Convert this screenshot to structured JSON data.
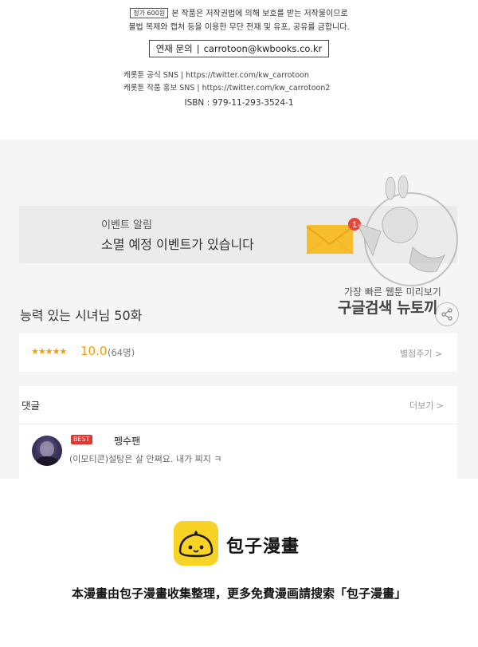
{
  "credits": {
    "price_tag": "정가 600원",
    "notice_line1": "본 작품은 저작권법에 의해 보호를 받는 저작물이므로",
    "notice_line2": "불법 복제와 캡처 등을 이용한 무단 전재 및 유포, 공유를 금합니다.",
    "contact_label": "연재 문의",
    "contact_email": "carrotoon@kwbooks.co.kr",
    "sns_official": "캐롯툰 공식 SNS | https://twitter.com/kw_carrotoon",
    "sns_promo": "캐롯툰 작품 홍보 SNS | https://twitter.com/kw_carrotoon2",
    "isbn": "ISBN : 979-11-293-3524-1"
  },
  "event": {
    "label": "이벤트 알림",
    "title": "소멸 예정 이벤트가 있습니다",
    "badge_count": "1",
    "icon": "envelope-icon"
  },
  "episode": {
    "title": "능력 있는 시녀님 50화",
    "share_icon": "share-icon"
  },
  "rating": {
    "stars": "★★★★★",
    "score": "10.0",
    "count": "(64명)",
    "link": "별점주기 >"
  },
  "comments": {
    "header": "댓글",
    "more": "더보기 >",
    "items": [
      {
        "badge": "BEST",
        "user": "펭수팬",
        "text": "(이모티콘)설탕은 살 안쪄요. 내가 찌지 ㅋ"
      }
    ]
  },
  "watermark": {
    "line1": "가장 빠른 웹툰 미리보기",
    "line2": "구글검색 뉴토끼"
  },
  "footer": {
    "logo_text": "包子漫畫",
    "note": "本漫畫由包子漫畫收集整理，更多免費漫画請搜索「包子漫畫」"
  },
  "colors": {
    "accent_orange": "#f0a000",
    "badge_red": "#e8342c",
    "envelope_yellow": "#f6be2c",
    "logo_yellow": "#f8d224"
  }
}
